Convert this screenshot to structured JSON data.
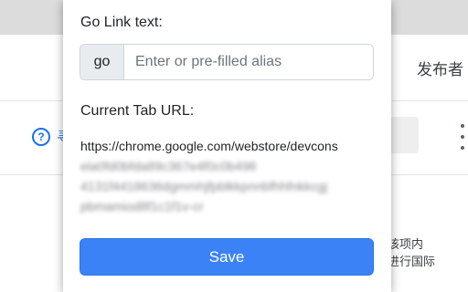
{
  "background": {
    "publisher_label": "发布者",
    "help_link": "寻",
    "text_line_1": "该项内",
    "text_line_2": "进行国际"
  },
  "popup": {
    "go_link_label": "Go Link text:",
    "go_prefix": "go",
    "alias_placeholder": "Enter or pre-filled alias",
    "alias_value": "",
    "current_url_label": "Current Tab URL:",
    "current_url_visible": "https://chrome.google.com/webstore/devcons",
    "save_label": "Save"
  },
  "colors": {
    "accent": "#3b82f6",
    "link": "#1a73e8"
  }
}
